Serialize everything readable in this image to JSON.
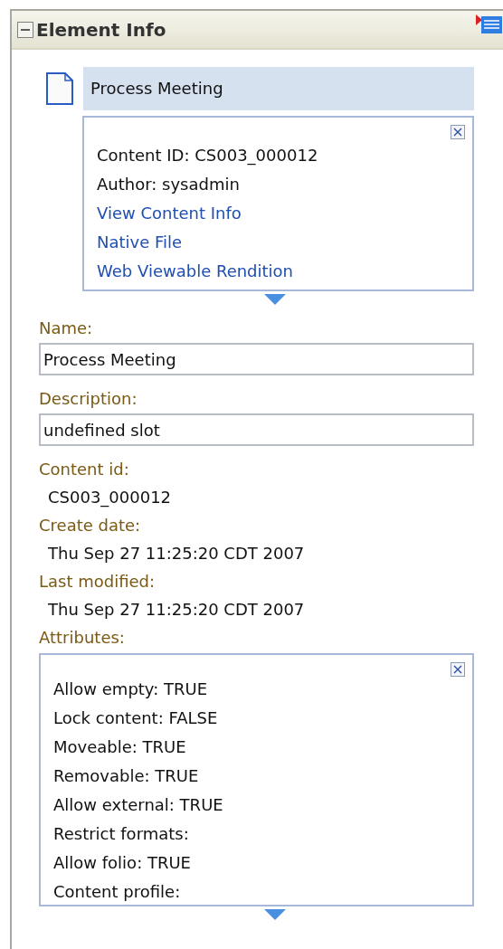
{
  "panel": {
    "title": "Element Info",
    "expanded": true
  },
  "item": {
    "title": "Process Meeting"
  },
  "info_box": {
    "lines": [
      {
        "kind": "text",
        "text": "Content ID: CS003_000012"
      },
      {
        "kind": "text",
        "text": "Author: sysadmin"
      },
      {
        "kind": "link",
        "text": "View Content Info"
      },
      {
        "kind": "link",
        "text": "Native File"
      },
      {
        "kind": "link",
        "text": "Web Viewable Rendition"
      }
    ]
  },
  "fields": [
    {
      "label": "Name:",
      "value": "Process Meeting"
    },
    {
      "label": "Description:",
      "value": "undefined slot"
    }
  ],
  "properties": [
    {
      "label": "Content id:",
      "value": "CS003_000012"
    },
    {
      "label": "Create date:",
      "value": "Thu Sep 27 11:25:20 CDT 2007"
    },
    {
      "label": "Last modified:",
      "value": "Thu Sep 27 11:25:20 CDT 2007"
    }
  ],
  "attributes": {
    "label": "Attributes:",
    "lines": [
      "Allow empty: TRUE",
      "Lock content: FALSE",
      "Moveable: TRUE",
      "Removable: TRUE",
      "Allow external: TRUE",
      "Restrict formats:",
      "Allow folio: TRUE",
      "Content profile:"
    ]
  }
}
